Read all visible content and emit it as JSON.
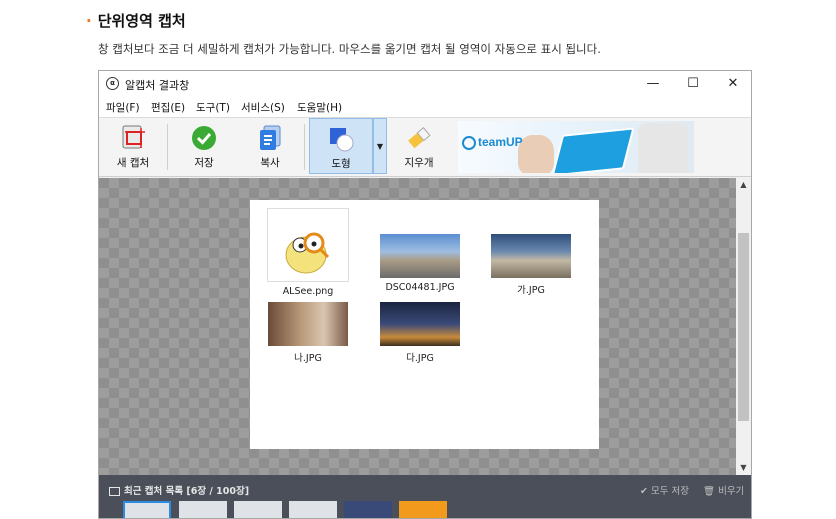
{
  "section": {
    "title": "단위영역 캡처",
    "description": "창 캡처보다 조금 더 세밀하게 캡처가 가능합니다. 마우스를 옮기면 캡처 될 영역이 자동으로 표시 됩니다."
  },
  "window": {
    "title": "알캡처 결과창",
    "controls": {
      "minimize": "—",
      "maximize": "☐",
      "close": "✕"
    }
  },
  "menu": [
    "파일(F)",
    "편집(E)",
    "도구(T)",
    "서비스(S)",
    "도움말(H)"
  ],
  "toolbar": {
    "new_capture": "새 캡처",
    "save": "저장",
    "copy": "복사",
    "shape": "도형",
    "eraser": "지우개"
  },
  "banner": {
    "logo_text": "teamUP"
  },
  "files": [
    {
      "name": "ALSee.png",
      "color": "#f2e07a"
    },
    {
      "name": "DSC04481.JPG",
      "color": "#6b8fb5"
    },
    {
      "name": "가.JPG",
      "color": "#8aa0b8"
    },
    {
      "name": "나.JPG",
      "color": "#b08868"
    },
    {
      "name": "다.JPG",
      "color": "#3a4a6a"
    }
  ],
  "bottom": {
    "recent_label": "최근 캡처 목록 [6장 / 100장]",
    "save_all": "✔ 모두 저장",
    "clear": "🗑 비우기"
  }
}
